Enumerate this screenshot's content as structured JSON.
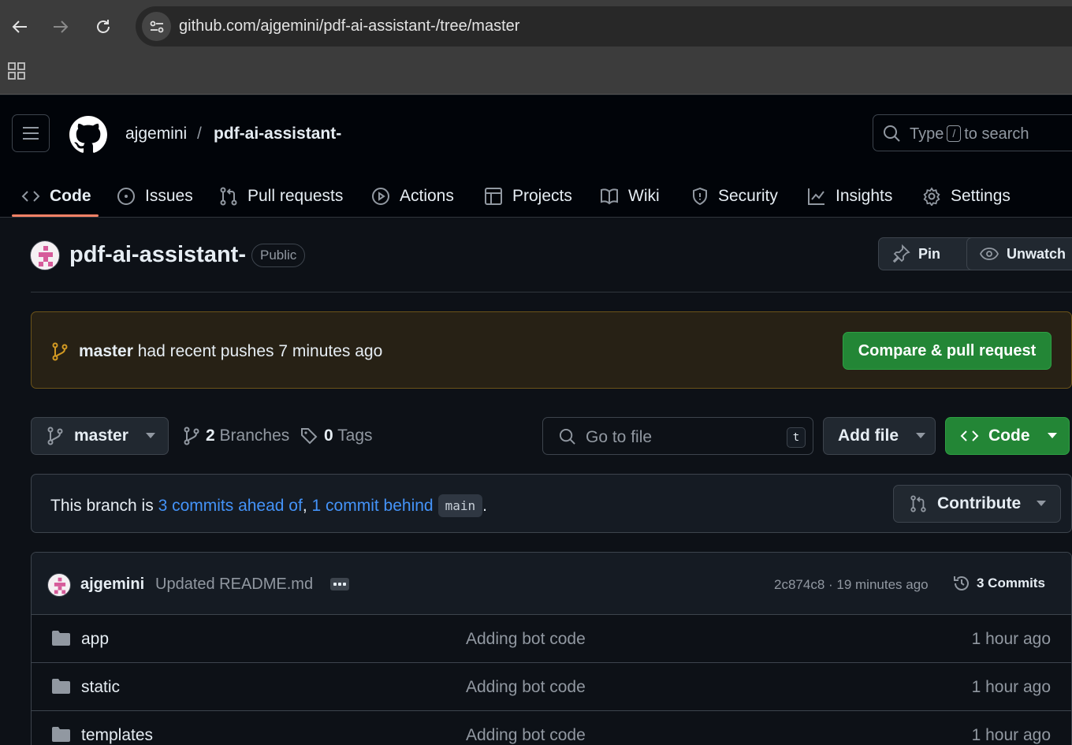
{
  "browser": {
    "url": "github.com/ajgemini/pdf-ai-assistant-/tree/master"
  },
  "header": {
    "owner": "ajgemini",
    "separator": "/",
    "repo": "pdf-ai-assistant-",
    "search": {
      "prefix": "Type",
      "key": "/",
      "suffix": "to search"
    }
  },
  "tabs": [
    {
      "label": "Code",
      "icon": "code-icon",
      "active": true
    },
    {
      "label": "Issues",
      "icon": "issue-icon"
    },
    {
      "label": "Pull requests",
      "icon": "pull-request-icon"
    },
    {
      "label": "Actions",
      "icon": "play-icon"
    },
    {
      "label": "Projects",
      "icon": "table-icon"
    },
    {
      "label": "Wiki",
      "icon": "book-icon"
    },
    {
      "label": "Security",
      "icon": "shield-icon"
    },
    {
      "label": "Insights",
      "icon": "graph-icon"
    },
    {
      "label": "Settings",
      "icon": "gear-icon"
    }
  ],
  "repo_head": {
    "name": "pdf-ai-assistant-",
    "visibility": "Public",
    "pin_label": "Pin",
    "unwatch_label": "Unwatch"
  },
  "push_banner": {
    "branch": "master",
    "text": "had recent pushes 7 minutes ago",
    "button": "Compare & pull request"
  },
  "toolbar": {
    "branch": "master",
    "branches_count": "2",
    "branches_label": "Branches",
    "tags_count": "0",
    "tags_label": "Tags",
    "goto_placeholder": "Go to file",
    "goto_key": "t",
    "add_file": "Add file",
    "code": "Code"
  },
  "branch_status": {
    "prefix": "This branch is",
    "ahead": "3 commits ahead of",
    "comma": ",",
    "behind": "1 commit behind",
    "base": "main",
    "period": ".",
    "contribute": "Contribute"
  },
  "latest_commit": {
    "author": "ajgemini",
    "message": "Updated README.md",
    "meta": "2c874c8 · 19 minutes ago",
    "commits_label": "3 Commits"
  },
  "files": [
    {
      "name": "app",
      "message": "Adding bot code",
      "time": "1 hour ago"
    },
    {
      "name": "static",
      "message": "Adding bot code",
      "time": "1 hour ago"
    },
    {
      "name": "templates",
      "message": "Adding bot code",
      "time": "1 hour ago"
    }
  ],
  "colors": {
    "accent_green": "#238636",
    "link_blue": "#4493f8",
    "tab_underline": "#f78166",
    "banner_bg": "#272115"
  }
}
